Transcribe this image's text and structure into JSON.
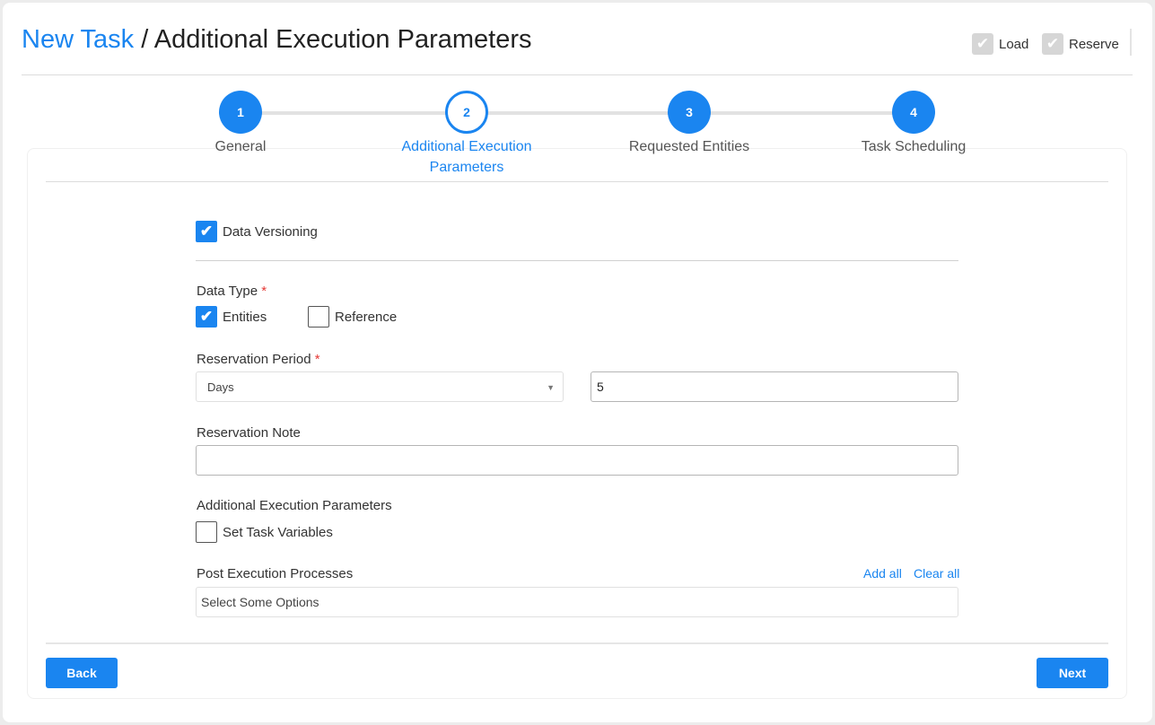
{
  "header": {
    "title_link": "New Task",
    "title_rest": " / Additional Execution Parameters",
    "load_label": "Load",
    "reserve_label": "Reserve"
  },
  "stepper": {
    "steps": [
      {
        "num": "1",
        "label": "General"
      },
      {
        "num": "2",
        "label": "Additional Execution Parameters"
      },
      {
        "num": "3",
        "label": "Requested Entities"
      },
      {
        "num": "4",
        "label": "Task Scheduling"
      }
    ],
    "active": 2
  },
  "form": {
    "data_versioning": {
      "label": "Data Versioning",
      "checked": true
    },
    "data_type": {
      "label": "Data Type",
      "required": "*",
      "options": [
        {
          "label": "Entities",
          "checked": true
        },
        {
          "label": "Reference",
          "checked": false
        }
      ]
    },
    "reservation_period": {
      "label": "Reservation Period",
      "required": "*",
      "unit": "Days",
      "value": "5"
    },
    "reservation_note": {
      "label": "Reservation Note",
      "value": ""
    },
    "additional": {
      "label": "Additional Execution Parameters",
      "set_vars_label": "Set Task Variables",
      "set_vars_checked": false
    },
    "post_exec": {
      "label": "Post Execution Processes",
      "add_all": "Add all",
      "clear_all": "Clear all",
      "placeholder": "Select Some Options"
    }
  },
  "footer": {
    "back": "Back",
    "next": "Next"
  },
  "colors": {
    "accent": "#1a85f0",
    "required": "#e53935"
  }
}
